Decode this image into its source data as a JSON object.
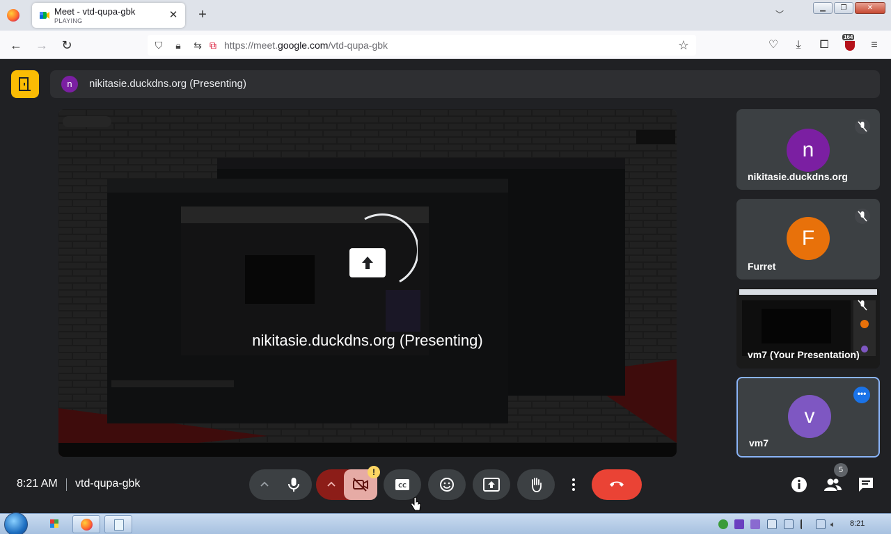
{
  "browser": {
    "tab": {
      "title": "Meet - vtd-qupa-gbk",
      "subtitle": "PLAYING"
    },
    "url": {
      "prefix": "https://meet.",
      "domain": "google.com",
      "path": "/vtd-qupa-gbk"
    },
    "badge_count": "164"
  },
  "meet": {
    "presenter_bar": {
      "avatar_letter": "n",
      "label": "nikitasie.duckdns.org (Presenting)"
    },
    "stage_label": "nikitasie.duckdns.org (Presenting)",
    "participants": [
      {
        "letter": "n",
        "name": "nikitasie.duckdns.org",
        "color": "#7b1fa2",
        "muted": true
      },
      {
        "letter": "F",
        "name": "Furret",
        "color": "#e8710a",
        "muted": true
      },
      {
        "letter": "",
        "name": "vm7 (Your Presentation)",
        "color": "#1b1b1b",
        "muted": true
      },
      {
        "letter": "v",
        "name": "vm7",
        "color": "#7e57c2",
        "muted": false
      }
    ],
    "clock": "8:21 AM",
    "meeting_code": "vtd-qupa-gbk",
    "camera_alert": "!",
    "people_count": "5"
  },
  "taskbar": {
    "clock": "8:21"
  },
  "colors": {
    "end_call": "#ea4335",
    "camera_off": "#8c1d18",
    "accent": "#1a73e8",
    "room_icon": "#fbbc04"
  }
}
